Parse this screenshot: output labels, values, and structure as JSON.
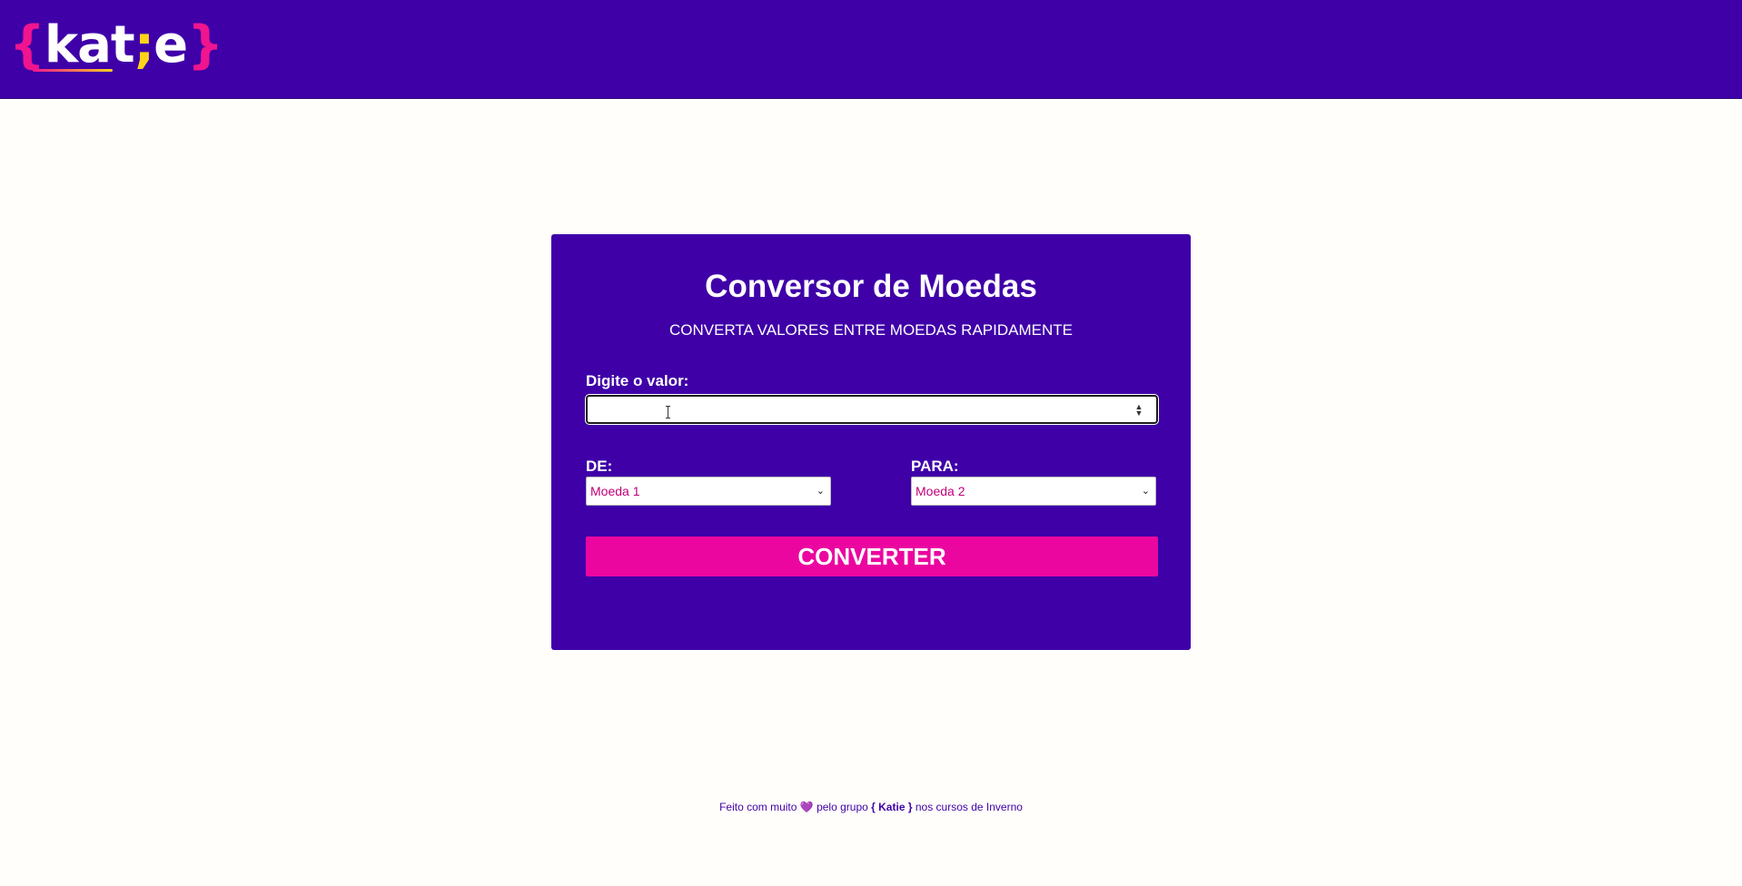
{
  "header": {
    "logo": {
      "open_brace": "{",
      "text_before": "kat",
      "semicolon": ";",
      "text_after": "e",
      "close_brace": "}"
    },
    "colors": {
      "background": "#3f00a8",
      "brace": "#f0148f",
      "semicolon": "#ffd21a"
    }
  },
  "converter": {
    "title": "Conversor de Moedas",
    "subtitle": "CONVERTA VALORES ENTRE MOEDAS RAPIDAMENTE",
    "value_label": "Digite o valor:",
    "value_input": {
      "value": "",
      "placeholder": ""
    },
    "from_label": "DE:",
    "from_select": {
      "selected": "Moeda 1"
    },
    "to_label": "PARA:",
    "to_select": {
      "selected": "Moeda 2"
    },
    "convert_button": "CONVERTER",
    "colors": {
      "card": "#3f00a8",
      "button": "#eb06a0",
      "select_text": "#c0007a"
    }
  },
  "footer": {
    "text_1": "Feito com muito",
    "heart": "💜",
    "text_2": "pelo grupo",
    "group_name": "{ Katie }",
    "text_3": "nos cursos de Inverno"
  },
  "icons": {
    "heart": "heart-icon",
    "chevron": "chevron-down-icon",
    "spinner": "number-spinner-icon"
  }
}
